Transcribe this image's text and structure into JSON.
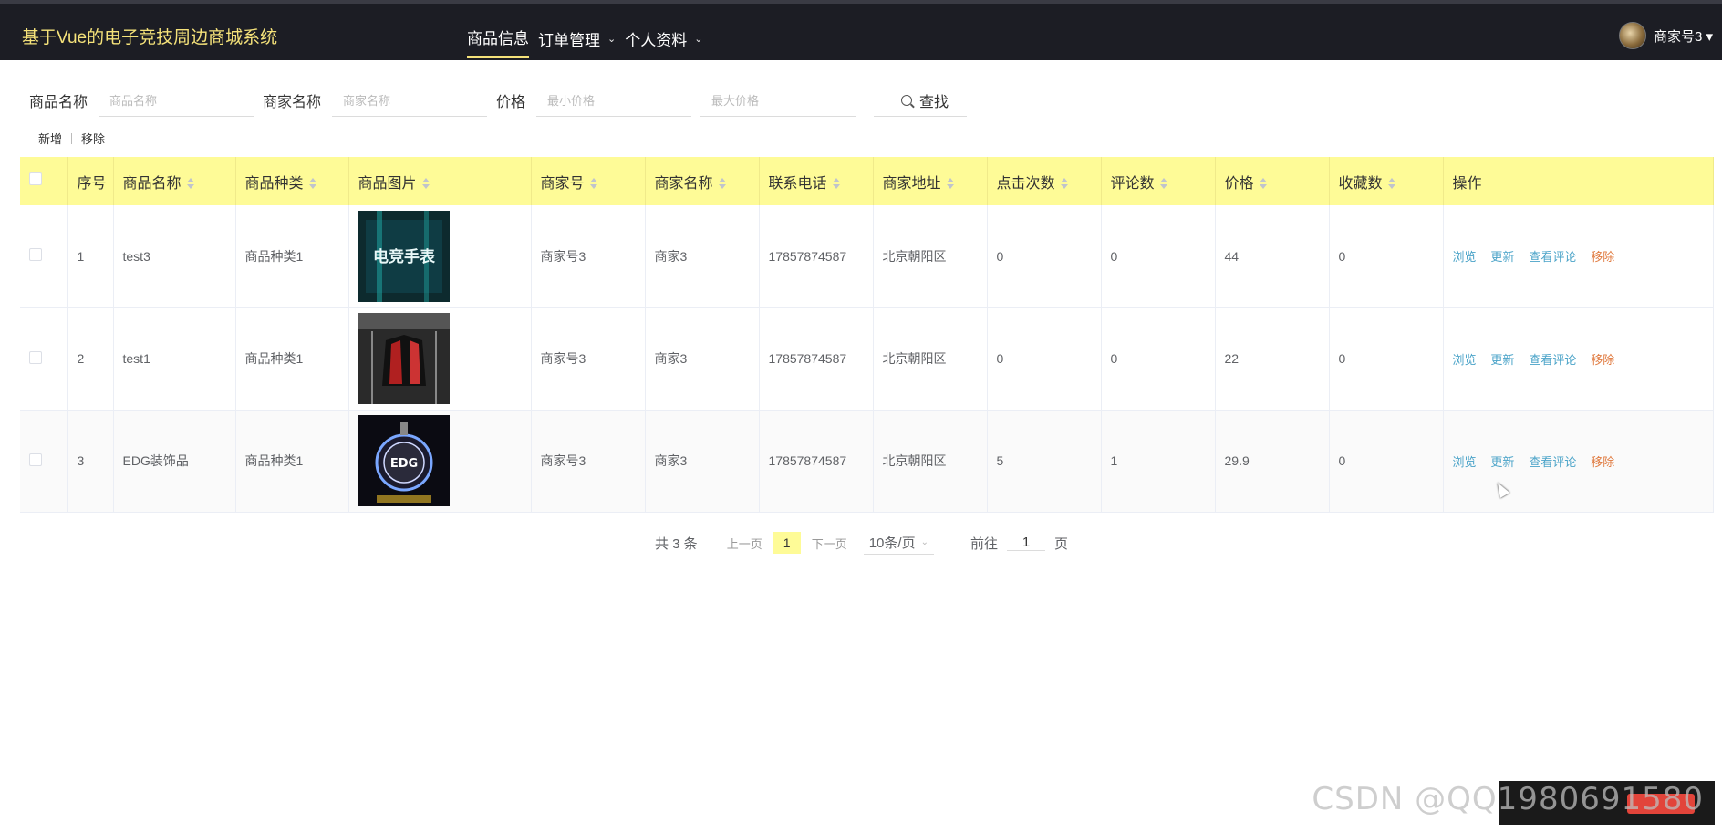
{
  "app": {
    "title": "基于Vue的电子竞技周边商城系统"
  },
  "nav": {
    "items": [
      {
        "label": "商品信息",
        "active": true,
        "dropdown": false
      },
      {
        "label": "订单管理",
        "active": false,
        "dropdown": true
      },
      {
        "label": "个人资料",
        "active": false,
        "dropdown": true
      }
    ]
  },
  "user": {
    "name": "商家号3 ▾"
  },
  "filters": {
    "product_name_label": "商品名称",
    "product_name_placeholder": "商品名称",
    "merchant_name_label": "商家名称",
    "merchant_name_placeholder": "商家名称",
    "price_label": "价格",
    "min_price_placeholder": "最小价格",
    "max_price_placeholder": "最大价格",
    "search_label": "查找"
  },
  "actions": {
    "add_label": "新增",
    "remove_label": "移除"
  },
  "table": {
    "headers": [
      "序号",
      "商品名称",
      "商品种类",
      "商品图片",
      "商家号",
      "商家名称",
      "联系电话",
      "商家地址",
      "点击次数",
      "评论数",
      "价格",
      "收藏数",
      "操作"
    ],
    "rows": [
      {
        "index": "1",
        "name": "test3",
        "category": "商品种类1",
        "image": "esports-watch-image",
        "merchant_id": "商家号3",
        "merchant_name": "商家3",
        "phone": "17857874587",
        "address": "北京朝阳区",
        "clicks": "0",
        "comments": "0",
        "price": "44",
        "favorites": "0"
      },
      {
        "index": "2",
        "name": "test1",
        "category": "商品种类1",
        "image": "jersey-rack-image",
        "merchant_id": "商家号3",
        "merchant_name": "商家3",
        "phone": "17857874587",
        "address": "北京朝阳区",
        "clicks": "0",
        "comments": "0",
        "price": "22",
        "favorites": "0"
      },
      {
        "index": "3",
        "name": "EDG装饰品",
        "category": "商品种类1",
        "image": "edg-keychain-image",
        "merchant_id": "商家号3",
        "merchant_name": "商家3",
        "phone": "17857874587",
        "address": "北京朝阳区",
        "clicks": "5",
        "comments": "1",
        "price": "29.9",
        "favorites": "0"
      }
    ],
    "ops": {
      "view": "浏览",
      "update": "更新",
      "comments": "查看评论",
      "remove": "移除"
    },
    "image_text": {
      "watch": "电竞手表",
      "edg": "EDG"
    }
  },
  "pagination": {
    "total": "共 3 条",
    "prev": "上一页",
    "current": "1",
    "next": "下一页",
    "page_size": "10条/页",
    "goto_label": "前往",
    "goto_value": "1",
    "goto_suffix": "页"
  },
  "watermark": "CSDN @QQ1980691580",
  "colors": {
    "header_bg": "#1c1d24",
    "accent_yellow": "#fefb97",
    "link_blue": "#4aa3c8",
    "remove_orange": "#e07a3f",
    "brand_yellow": "#f5e27a"
  }
}
